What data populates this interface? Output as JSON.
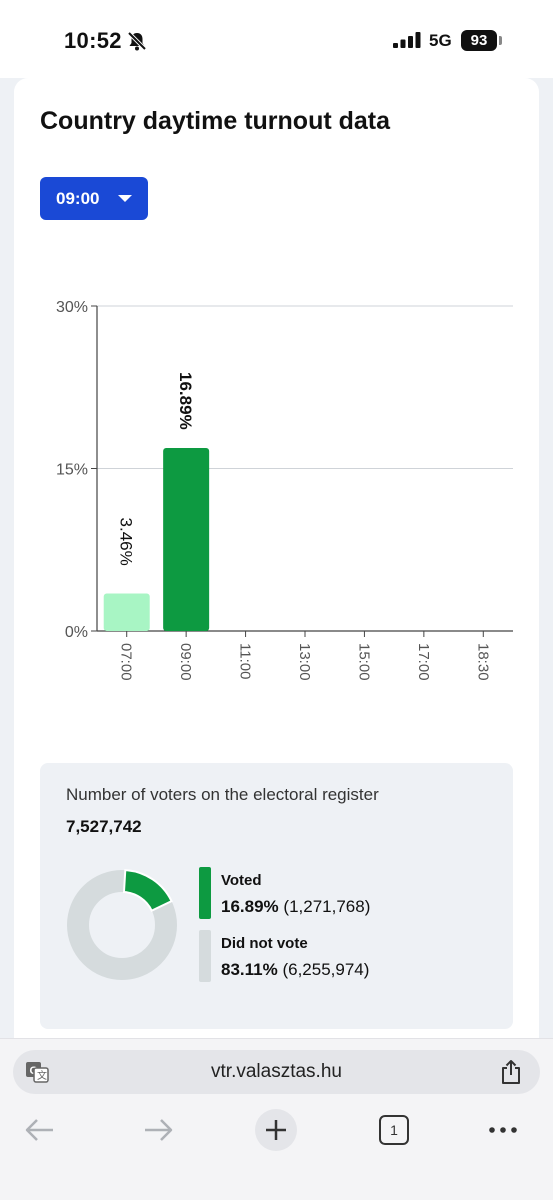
{
  "status_bar": {
    "time": "10:52",
    "network": "5G",
    "battery": "93",
    "icons": [
      "bell-slash-icon",
      "signal-icon",
      "battery-icon"
    ]
  },
  "card": {
    "title": "Country daytime turnout data"
  },
  "time_selector": {
    "value": "09:00"
  },
  "chart_data": {
    "type": "bar",
    "categories": [
      "07:00",
      "09:00",
      "11:00",
      "13:00",
      "15:00",
      "17:00",
      "18:30"
    ],
    "values": [
      3.46,
      16.89,
      null,
      null,
      null,
      null,
      null
    ],
    "data_labels": [
      "3.46%",
      "16.89%",
      "",
      "",
      "",
      "",
      ""
    ],
    "yticks": [
      "0%",
      "15%",
      "30%"
    ],
    "ylim": [
      0,
      30
    ],
    "grid": true,
    "title": "",
    "xlabel": "",
    "ylabel": "",
    "colors": {
      "highlight": "#0d9a41",
      "other": "#a8f5c4",
      "grid": "#cfd3d8",
      "axis": "#444444"
    },
    "highlight_category": "09:00"
  },
  "summary": {
    "register_label": "Number of voters on the electoral register",
    "register_count": "7,527,742",
    "donut": {
      "voted_fraction": 0.1689,
      "colors": {
        "voted": "#0d9a41",
        "not_voted": "#d5dbdd"
      }
    },
    "legend": [
      {
        "name": "Voted",
        "percent": "16.89%",
        "count": "(1,271,768)",
        "color": "#0d9a41"
      },
      {
        "name": "Did not vote",
        "percent": "83.11%",
        "count": "(6,255,974)",
        "color": "#d5dbdd"
      }
    ]
  },
  "browser": {
    "url": "vtr.valasztas.hu",
    "tab_count": "1",
    "icons": [
      "translate-icon",
      "share-icon",
      "back-arrow-icon",
      "forward-arrow-icon",
      "new-tab-plus-icon",
      "tabs-icon",
      "more-icon"
    ]
  }
}
